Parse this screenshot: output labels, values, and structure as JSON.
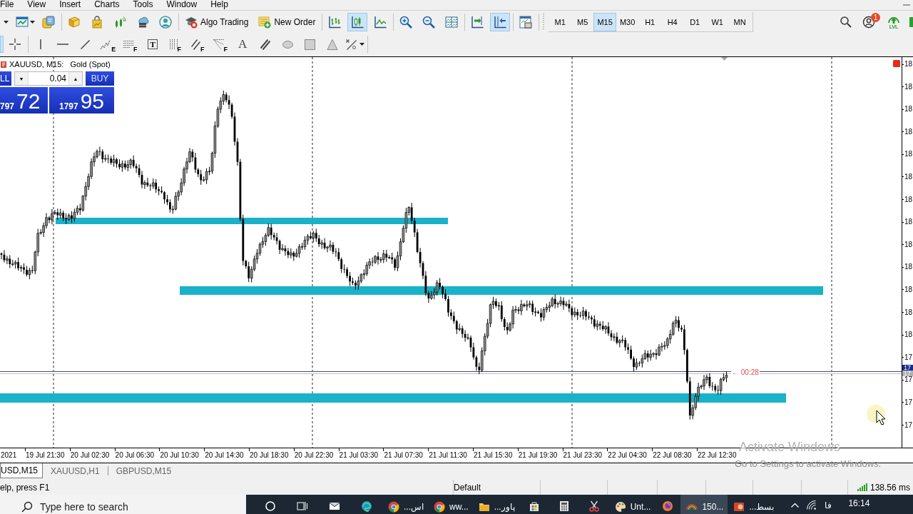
{
  "menu": [
    "File",
    "View",
    "Insert",
    "Charts",
    "Tools",
    "Window",
    "Help"
  ],
  "toolbar": {
    "actions": [
      {
        "kind": "algo",
        "label": "Algo Trading"
      },
      {
        "kind": "order",
        "label": "New Order"
      }
    ],
    "chart_types": [
      {
        "kind": "bars",
        "selected": false
      },
      {
        "kind": "candles",
        "selected": true
      },
      {
        "kind": "line",
        "selected": false
      }
    ],
    "scroll_toggles": [
      {
        "kind": "shift",
        "on": false
      },
      {
        "kind": "autoscroll",
        "on": true
      }
    ],
    "timeframes": [
      {
        "label": "M1",
        "selected": false
      },
      {
        "label": "M5",
        "selected": false
      },
      {
        "label": "M15",
        "selected": true
      },
      {
        "label": "M30",
        "selected": false
      },
      {
        "label": "H1",
        "selected": false
      },
      {
        "label": "H4",
        "selected": false
      },
      {
        "label": "D1",
        "selected": false
      },
      {
        "label": "W1",
        "selected": false
      },
      {
        "label": "MN",
        "selected": false
      }
    ],
    "notification_count": "1",
    "level_label": "LVL"
  },
  "drawing_tools": [
    {
      "kind": "cursor",
      "selected": true
    },
    {
      "kind": "crosshair",
      "selected": false
    },
    {
      "kind": "vline",
      "selected": false
    },
    {
      "kind": "hline",
      "selected": false
    },
    {
      "kind": "trendline",
      "selected": false
    },
    {
      "kind": "elliott",
      "selected": false,
      "glyph": "E"
    },
    {
      "kind": "fibo",
      "selected": false,
      "glyph": "F"
    },
    {
      "kind": "label",
      "selected": false,
      "glyph": "T"
    },
    {
      "kind": "fibo-time",
      "selected": false,
      "glyph": "F"
    },
    {
      "kind": "fibo-channel",
      "selected": false,
      "glyph": "F"
    },
    {
      "kind": "fibo-fan",
      "selected": false,
      "glyph": "F"
    },
    {
      "kind": "text",
      "selected": false,
      "glyph": "A"
    },
    {
      "kind": "channel",
      "selected": false
    },
    {
      "kind": "ellipse",
      "selected": false
    },
    {
      "kind": "rectangle",
      "selected": false
    },
    {
      "kind": "triangle",
      "selected": false
    },
    {
      "kind": "shapes",
      "selected": false
    }
  ],
  "chart": {
    "symbol": "XAUUSD, M15:",
    "description": "Gold (Spot)",
    "trade_panel": {
      "sell_label": "LL",
      "lot_down": "▼",
      "lot": "0.04",
      "lot_up": "▲",
      "buy_label": "BUY",
      "sell_price": {
        "prefix": "797",
        "main": "72"
      },
      "buy_price": {
        "prefix": "1797",
        "main": "95"
      }
    },
    "countdown": "← 00:28",
    "price_axis": [
      "18",
      "18",
      "18",
      "18",
      "18",
      "18",
      "18",
      "18",
      "18",
      "18",
      "18",
      "18",
      "18",
      "17",
      "17",
      "17",
      "17"
    ],
    "bid_tag": "17",
    "ask_tag": "17",
    "time_axis": [
      "2021",
      "19 Jul 21:30",
      "20 Jul 02:30",
      "20 Jul 06:30",
      "20 Jul 10:30",
      "20 Jul 14:30",
      "20 Jul 18:30",
      "20 Jul 22:30",
      "21 Jul 03:30",
      "21 Jul 07:30",
      "21 Jul 11:30",
      "21 Jul 15:30",
      "21 Jul 19:30",
      "21 Jul 23:30",
      "22 Jul 04:30",
      "22 Jul 08:30",
      "22 Jul 12:30"
    ]
  },
  "chart_tabs": [
    {
      "label": "USD,M15",
      "selected": true
    },
    {
      "label": "XAUUSD,H1",
      "selected": false
    },
    {
      "label": "GBPUSD,M15",
      "selected": false
    }
  ],
  "status_bar": {
    "help": "elp, press F1",
    "profile": "Default",
    "ping": "138.56 ms"
  },
  "taskbar": {
    "search": {
      "placeholder": "Type here to search"
    },
    "apps": [
      {
        "kind": "cortana",
        "active": false
      },
      {
        "kind": "taskview",
        "active": false
      },
      {
        "kind": "mail",
        "active": false
      },
      {
        "kind": "edge",
        "active": false
      },
      {
        "kind": "chrome",
        "active": false,
        "label": "اس..."
      },
      {
        "kind": "chrome",
        "active": false,
        "label": "ww..."
      },
      {
        "kind": "folder",
        "active": false,
        "label": "پاور..."
      },
      {
        "kind": "store",
        "active": false
      },
      {
        "kind": "calc",
        "active": false
      },
      {
        "kind": "snip",
        "active": false
      },
      {
        "kind": "paint",
        "active": false,
        "label": "Unt..."
      },
      {
        "kind": "firefox",
        "active": false
      },
      {
        "kind": "alpari",
        "active": true,
        "label": "150..."
      },
      {
        "kind": "powerpoint",
        "active": false,
        "label": "بسط..."
      }
    ],
    "language": "فا",
    "time": "16:14"
  },
  "activation_notice": {
    "title": "Activate Windows",
    "hint": "Go to Settings to activate Windows."
  }
}
